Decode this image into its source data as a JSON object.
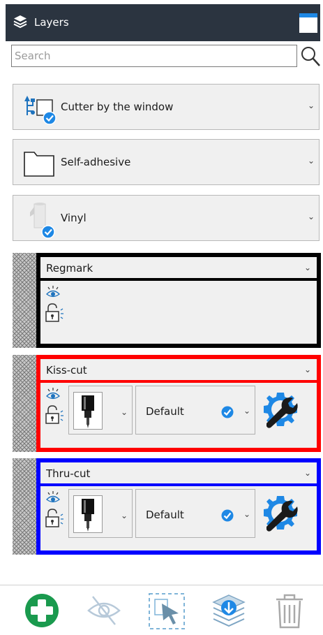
{
  "panel": {
    "title": "Layers"
  },
  "search": {
    "placeholder": "Search"
  },
  "selectors": [
    {
      "label": "Cutter by the window",
      "icon": "cutter-usb-icon"
    },
    {
      "label": "Self-adhesive",
      "icon": "folder-icon"
    },
    {
      "label": "Vinyl",
      "icon": "vinyl-roll-icon"
    }
  ],
  "layers": [
    {
      "name": "Regmark",
      "color": "#000000"
    },
    {
      "name": "Kiss-cut",
      "color": "#ff0000",
      "tool_icon": "knife-tool-icon",
      "preset": "Default"
    },
    {
      "name": "Thru-cut",
      "color": "#0000ff",
      "tool_icon": "knife-tool-icon",
      "preset": "Default"
    }
  ],
  "toolbar": [
    "add-layer-icon",
    "hide-eye-icon",
    "select-layer-icon",
    "layers-merge-icon",
    "trash-icon"
  ]
}
